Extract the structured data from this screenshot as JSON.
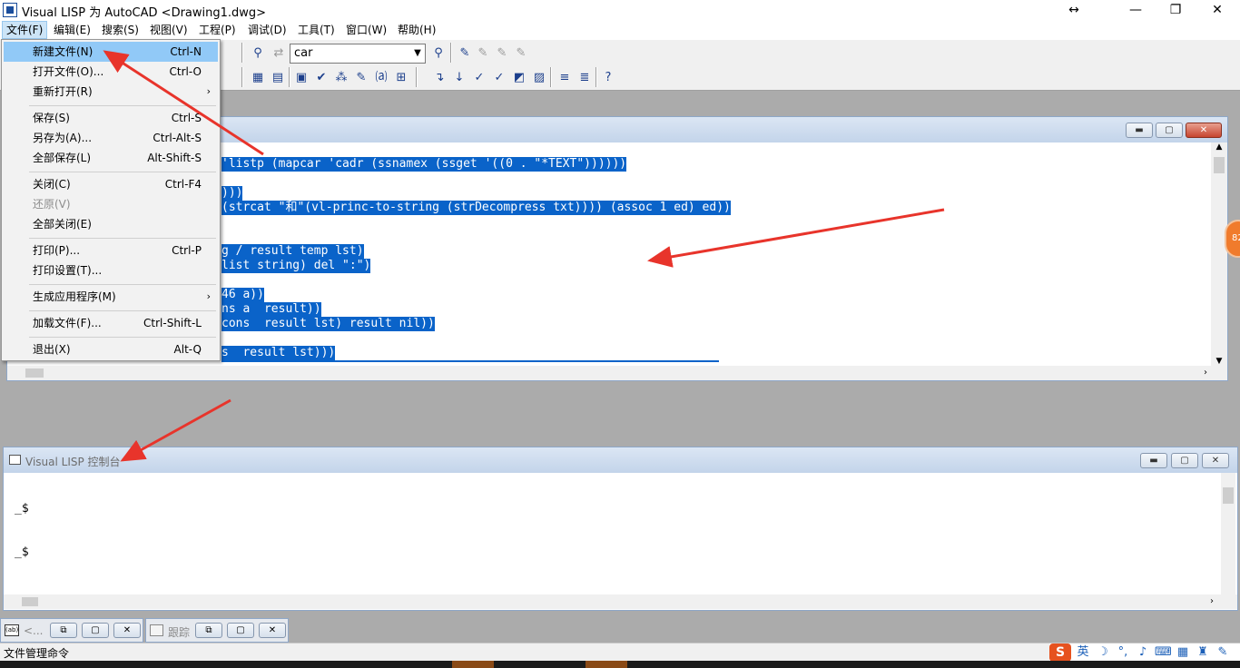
{
  "window": {
    "title": "Visual LISP 为 AutoCAD <Drawing1.dwg>",
    "controls": {
      "restore": "↔",
      "minimize": "—",
      "maximize": "❐",
      "close": "✕"
    }
  },
  "menubar": [
    "文件(F)",
    "编辑(E)",
    "搜索(S)",
    "视图(V)",
    "工程(P)",
    "调试(D)",
    "工具(T)",
    "窗口(W)",
    "帮助(H)"
  ],
  "toolbar": {
    "search_value": "car"
  },
  "file_menu": {
    "items": [
      {
        "label": "新建文件(N)",
        "shortcut": "Ctrl-N"
      },
      {
        "label": "打开文件(O)...",
        "shortcut": "Ctrl-O"
      },
      {
        "label": "重新打开(R)",
        "shortcut": "",
        "submenu": "›"
      },
      {
        "label": "保存(S)",
        "shortcut": "Ctrl-S"
      },
      {
        "label": "另存为(A)...",
        "shortcut": "Ctrl-Alt-S"
      },
      {
        "label": "全部保存(L)",
        "shortcut": "Alt-Shift-S"
      },
      {
        "label": "关闭(C)",
        "shortcut": "Ctrl-F4"
      },
      {
        "label": "还原(V)",
        "shortcut": ""
      },
      {
        "label": "全部关闭(E)",
        "shortcut": ""
      },
      {
        "label": "打印(P)...",
        "shortcut": "Ctrl-P"
      },
      {
        "label": "打印设置(T)...",
        "shortcut": ""
      },
      {
        "label": "生成应用程序(M)",
        "shortcut": "",
        "submenu": "›"
      },
      {
        "label": "加载文件(F)...",
        "shortcut": "Ctrl-Shift-L"
      },
      {
        "label": "退出(X)",
        "shortcut": "Alt-Q"
      }
    ]
  },
  "editor": {
    "lines": [
      "'listp (mapcar 'cadr (ssnamex (ssget '((0 . \"*TEXT\"))))))",
      ")))",
      "(strcat \"和\"(vl-princ-to-string (strDecompress txt)))) (assoc 1 ed) ed))",
      "g / result temp lst)",
      "list string) del \":\")",
      "46 a))",
      "ns a  result))",
      "cons  result lst) result nil))",
      "s  result lst)))"
    ]
  },
  "console": {
    "title": "Visual LISP 控制台",
    "lines": [
      "_$",
      "_$"
    ]
  },
  "minimized": [
    {
      "label": "<..."
    },
    {
      "label": "跟踪"
    }
  ],
  "status": {
    "text": "文件管理命令",
    "ime_lang": "英",
    "badge": "82"
  }
}
